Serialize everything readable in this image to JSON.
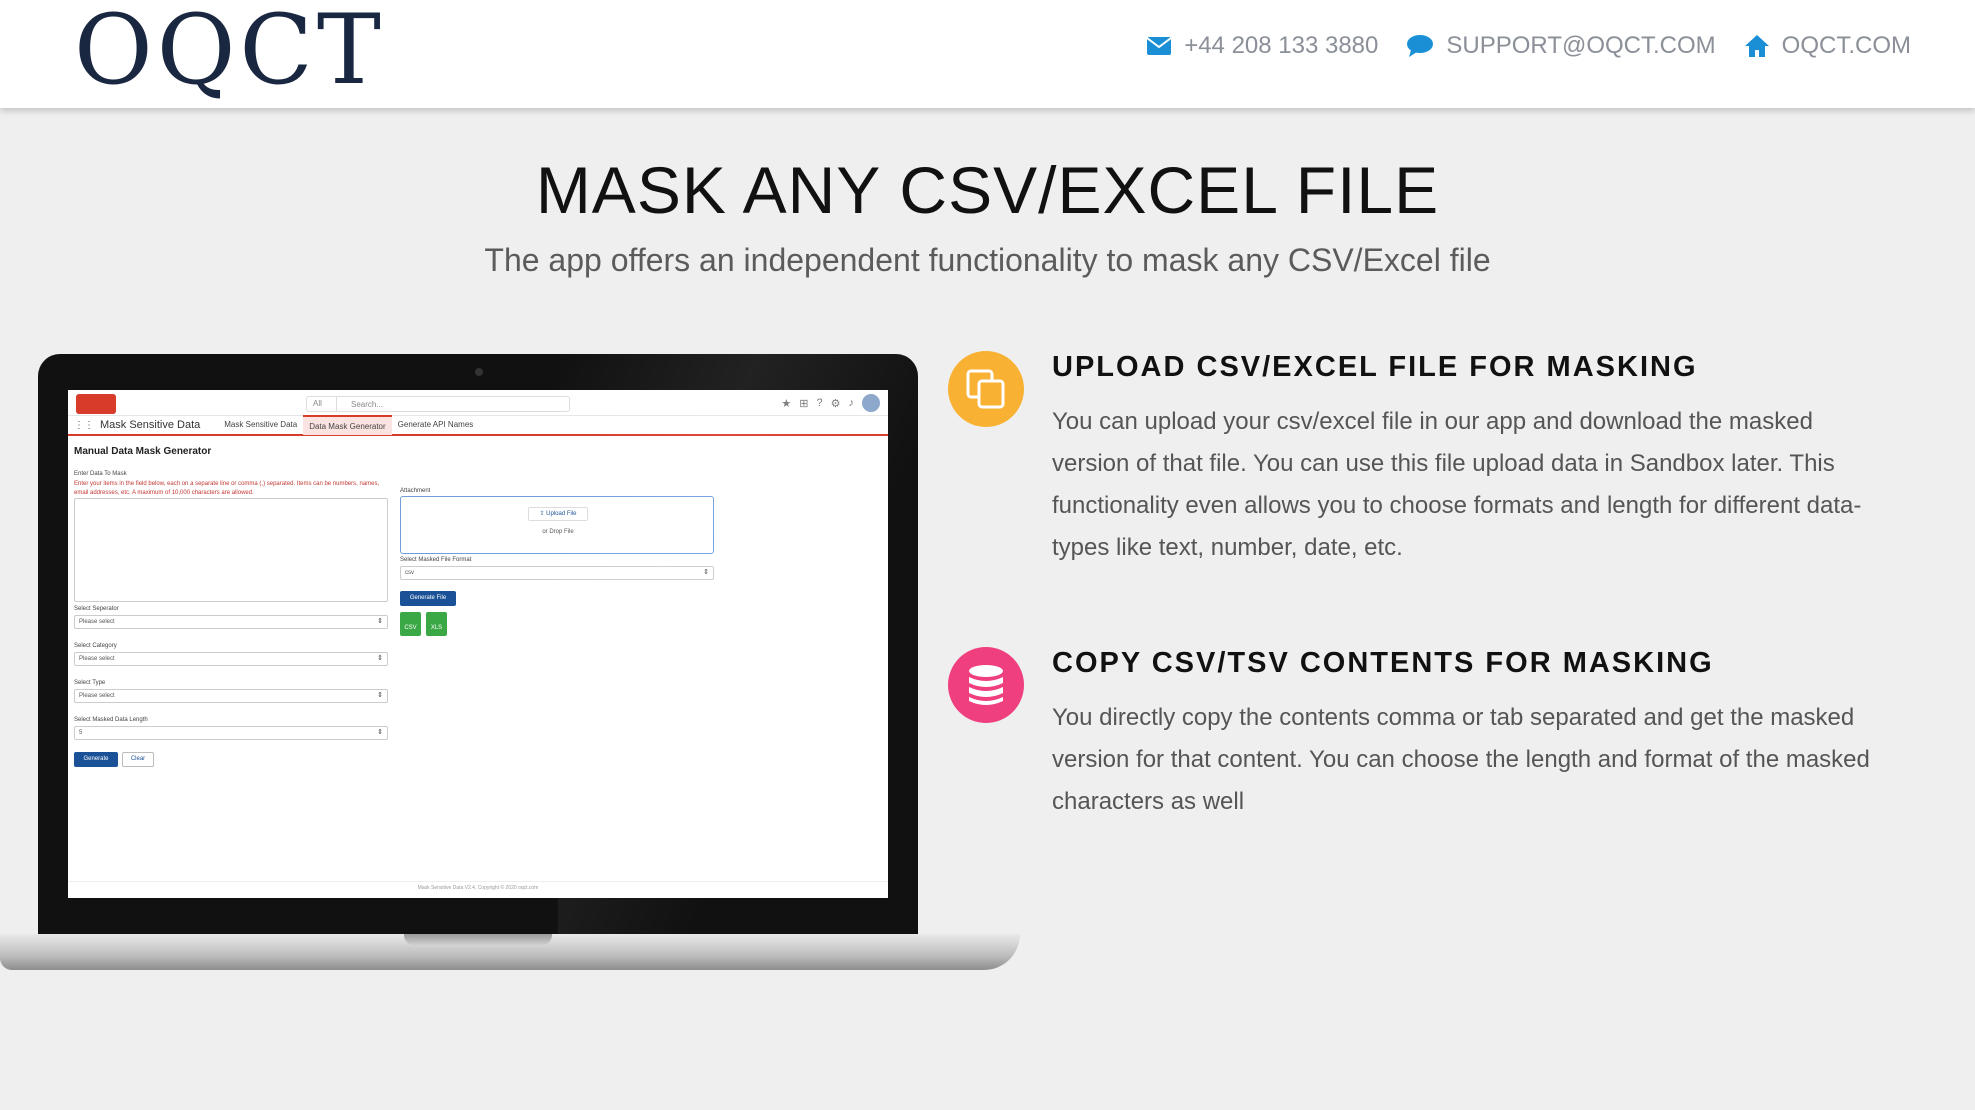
{
  "header": {
    "logo_text": "OQCT",
    "phone": "+44 208 133 3880",
    "email": "SUPPORT@OQCT.COM",
    "website": "OQCT.COM",
    "icons": [
      "envelope-icon",
      "chat-icon",
      "home-icon"
    ],
    "icon_color": "#1a8fd6"
  },
  "hero": {
    "title": "MASK ANY CSV/EXCEL FILE",
    "subtitle": "The app offers an independent functionality to mask any CSV/Excel file"
  },
  "screenshot_app": {
    "search_scope": "All",
    "search_placeholder": "Search...",
    "app_name": "Mask Sensitive Data",
    "tabs": [
      "Mask Sensitive Data",
      "Data Mask Generator",
      "Generate API Names"
    ],
    "active_tab": "Data Mask Generator",
    "page_title": "Manual Data Mask Generator",
    "enter_label": "Enter Data To Mask",
    "help_text": "Enter your items in the field below, each on a separate line or comma (,) separated. Items can be numbers, names, email addresses, etc. A maximum of 10,000 characters are allowed.",
    "attachment_label": "Attachment",
    "upload_button": "Upload File",
    "or_drop": "or Drop File",
    "format_label": "Select Masked File Format",
    "format_value": "csv",
    "generate_file_button": "Generate File",
    "file_icons": [
      "CSV",
      "XLS"
    ],
    "separator_label": "Select Seperator",
    "separator_value": "Please select",
    "category_label": "Select Category",
    "category_value": "Please select",
    "type_label": "Select Type",
    "type_value": "Please select",
    "length_label": "Select Masked Data Length",
    "length_value": "5",
    "generate_button": "Generate",
    "clear_button": "Clear",
    "footer": "Mask Sensitive Data V2.4, Copyright © 2020 oqct.com"
  },
  "features": [
    {
      "title": "UPLOAD CSV/EXCEL FILE FOR MASKING",
      "text": "You can upload your csv/excel file in our app and download the masked version of that file. You can use this file upload data in Sandbox later. This functionality even allows you to choose formats and length for different data-types like text, number, date, etc.",
      "icon": "copy-files-icon",
      "color": "#f8b133"
    },
    {
      "title": "COPY CSV/TSV CONTENTS FOR MASKING",
      "text": "You directly copy the contents comma or tab separated and get the masked version for that content. You can choose the length and format of the masked characters as well",
      "icon": "database-icon",
      "color": "#ef3f7f"
    }
  ]
}
